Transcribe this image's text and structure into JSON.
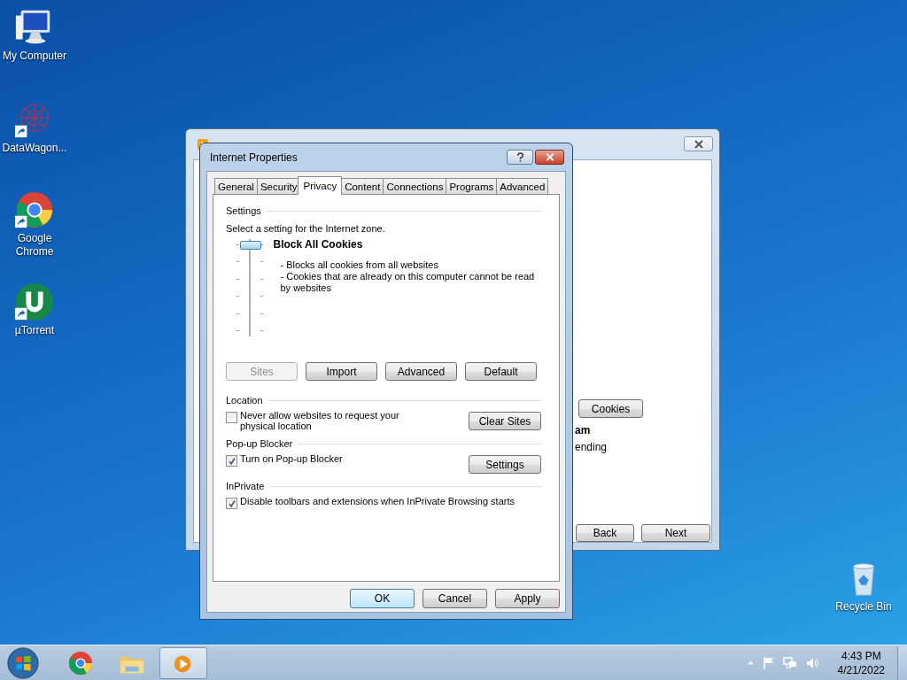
{
  "desktop_icons": [
    {
      "label": "My Computer",
      "kind": "computer",
      "shortcut": false
    },
    {
      "label": "DataWagon...",
      "kind": "web",
      "shortcut": true
    },
    {
      "label": "Google Chrome",
      "kind": "chrome",
      "shortcut": true
    },
    {
      "label": "µTorrent",
      "kind": "torrent",
      "shortcut": true
    },
    {
      "label": "Recycle Bin",
      "kind": "recycle",
      "shortcut": false
    }
  ],
  "background_window": {
    "cookies_button": "Cookies",
    "heading_fragment": "am",
    "text_fragment": "ending",
    "buttons": [
      "Back",
      "Next"
    ]
  },
  "dialog": {
    "title": "Internet Properties",
    "tabs": [
      {
        "label": "General",
        "selected": false
      },
      {
        "label": "Security",
        "selected": false
      },
      {
        "label": "Privacy",
        "selected": true
      },
      {
        "label": "Content",
        "selected": false
      },
      {
        "label": "Connections",
        "selected": false
      },
      {
        "label": "Programs",
        "selected": false
      },
      {
        "label": "Advanced",
        "selected": false
      }
    ],
    "settings": {
      "heading": "Settings",
      "prompt": "Select a setting for the Internet zone.",
      "level": 1,
      "level_title": "Block All Cookies",
      "description": [
        "- Blocks all cookies from all websites",
        "- Cookies that are already on this computer cannot be read by websites"
      ],
      "buttons": [
        {
          "label": "Sites",
          "disabled": true
        },
        {
          "label": "Import",
          "disabled": false
        },
        {
          "label": "Advanced",
          "disabled": false
        },
        {
          "label": "Default",
          "disabled": false
        }
      ]
    },
    "sections": [
      {
        "heading": "Location",
        "checkbox": {
          "label": "Never allow websites to request your physical location",
          "checked": false
        },
        "button": "Clear Sites"
      },
      {
        "heading": "Pop-up Blocker",
        "checkbox": {
          "label": "Turn on Pop-up Blocker",
          "checked": true
        },
        "button": "Settings"
      },
      {
        "heading": "InPrivate",
        "checkbox": {
          "label": "Disable toolbars and extensions when InPrivate Browsing starts",
          "checked": true
        }
      }
    ],
    "buttons": [
      {
        "label": "OK",
        "default": true
      },
      {
        "label": "Cancel",
        "default": false
      },
      {
        "label": "Apply",
        "default": false
      }
    ]
  },
  "taskbar": {
    "apps": [
      {
        "kind": "chrome",
        "selected": false
      },
      {
        "kind": "folder",
        "selected": false
      },
      {
        "kind": "media",
        "selected": true
      }
    ],
    "clock": {
      "time": "4:43 PM",
      "date": "4/21/2022"
    }
  }
}
